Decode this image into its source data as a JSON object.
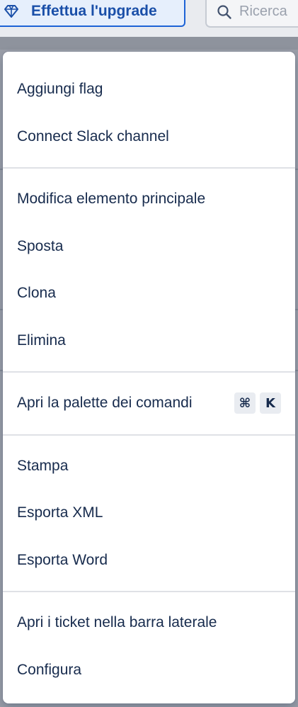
{
  "header": {
    "upgrade_label": "Effettua l'upgrade",
    "upgrade_icon": "diamond-icon",
    "search_placeholder": "Ricerca",
    "search_icon": "search-icon"
  },
  "menu": {
    "section_1": [
      {
        "label": "Aggiungi flag"
      },
      {
        "label": "Connect Slack channel"
      }
    ],
    "section_2": [
      {
        "label": "Modifica elemento principale"
      },
      {
        "label": "Sposta"
      },
      {
        "label": "Clona"
      },
      {
        "label": "Elimina"
      }
    ],
    "section_3": [
      {
        "label": "Apri la palette dei comandi",
        "shortcut_modifier": "⌘",
        "shortcut_key": "K"
      }
    ],
    "section_4": [
      {
        "label": "Stampa"
      },
      {
        "label": "Esporta XML"
      },
      {
        "label": "Esporta Word"
      }
    ],
    "section_5": [
      {
        "label": "Apri i ticket nella barra laterale"
      },
      {
        "label": "Configura"
      }
    ]
  },
  "colors": {
    "accent": "#1d63d6",
    "text": "#172b4d",
    "divider": "#dfe1e6",
    "overlay": "#9a9ea8"
  }
}
